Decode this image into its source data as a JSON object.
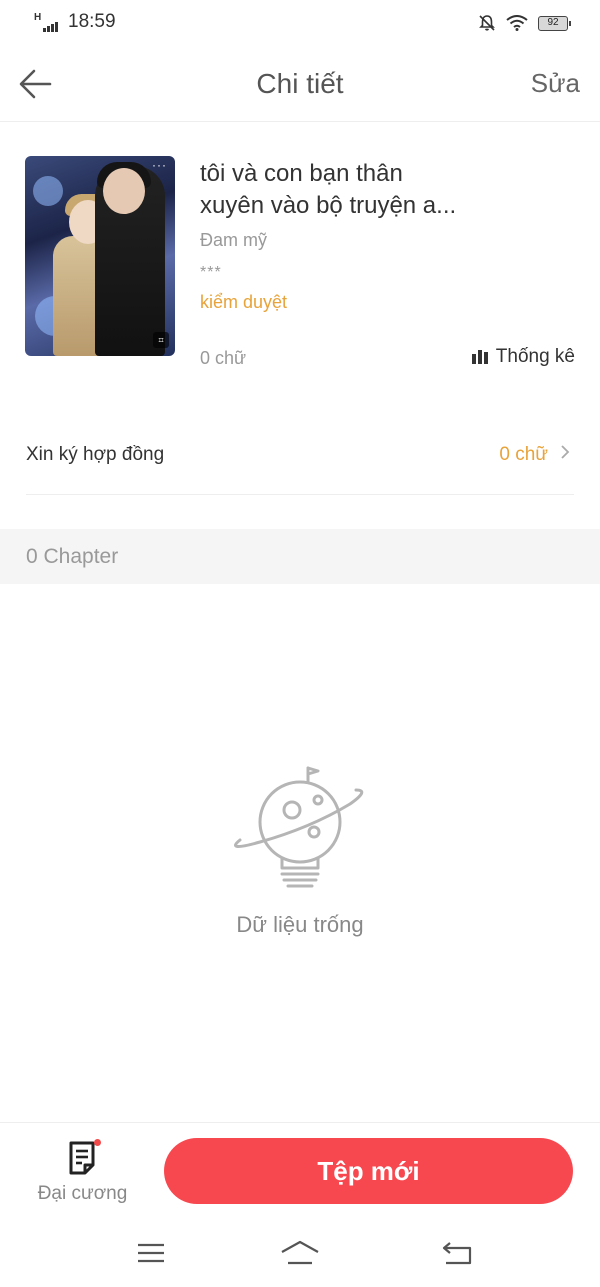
{
  "status_bar": {
    "network": "H",
    "time": "18:59",
    "battery": "92"
  },
  "nav": {
    "title": "Chi tiết",
    "edit_label": "Sửa"
  },
  "book": {
    "title_line1": "tôi và con bạn thân",
    "title_line2": "xuyên vào bộ truyện a...",
    "genre": "Đam mỹ",
    "stars": "***",
    "status": "kiểm duyệt",
    "word_count": "0 chữ",
    "stats_label": "Thống kê",
    "cover_dots": "···"
  },
  "contract": {
    "label": "Xin ký hợp đồng",
    "value": "0 chữ"
  },
  "chapters": {
    "count_label": "0 Chapter"
  },
  "empty": {
    "text": "Dữ liệu trống"
  },
  "bottom": {
    "outline_label": "Đại cương",
    "new_file_label": "Tệp mới"
  },
  "colors": {
    "accent": "#f74850",
    "status": "#e8a33a",
    "muted": "#999999"
  },
  "icons": {
    "back": "arrow-left-icon",
    "stats": "bar-chart-icon",
    "chevron": "chevron-right-icon",
    "outline": "document-list-icon",
    "empty": "lightbulb-planet-icon"
  }
}
